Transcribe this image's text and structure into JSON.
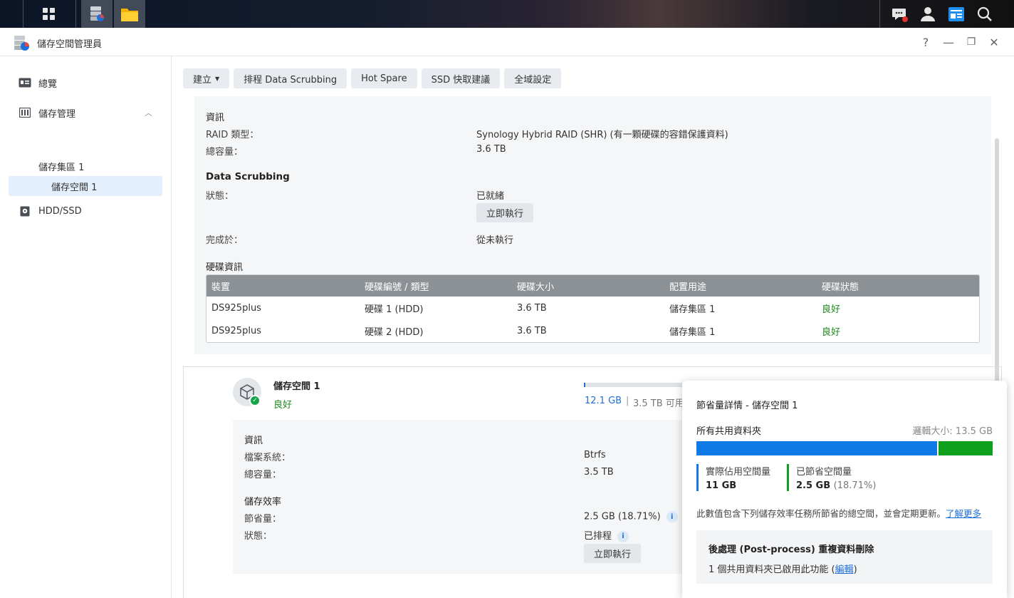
{
  "app": {
    "title": "儲存空間管理員"
  },
  "window_controls": {
    "help": "?",
    "minimize": "—",
    "restore": "❐",
    "close": "✕"
  },
  "sidebar": {
    "items": [
      {
        "label": "總覽",
        "icon": "overview-icon"
      },
      {
        "label": "儲存管理",
        "icon": "storage-icon"
      },
      {
        "label": "儲存集區 1"
      },
      {
        "label": "儲存空間 1"
      },
      {
        "label": "HDD/SSD",
        "icon": "hdd-icon"
      }
    ]
  },
  "toolbar": {
    "create": "建立",
    "schedule": "排程 Data Scrubbing",
    "hotspare": "Hot Spare",
    "ssd": "SSD 快取建議",
    "global": "全域設定"
  },
  "pool": {
    "info_title": "資訊",
    "raid_label": "RAID 類型：",
    "raid_value": "Synology Hybrid RAID (SHR) (有一顆硬碟的容錯保護資料)",
    "capacity_label": "總容量：",
    "capacity_value": "3.6 TB",
    "scrub_title": "Data Scrubbing",
    "status_label": "狀態：",
    "status_value": "已就緒",
    "run_now": "立即執行",
    "completed_label": "完成於：",
    "completed_value": "從未執行",
    "disk_title": "硬碟資訊",
    "table": {
      "headers": [
        "裝置",
        "硬碟編號 / 類型",
        "硬碟大小",
        "配置用途",
        "硬碟狀態"
      ],
      "rows": [
        [
          "DS925plus",
          "硬碟 1 (HDD)",
          "3.6 TB",
          "儲存集區 1",
          "良好"
        ],
        [
          "DS925plus",
          "硬碟 2 (HDD)",
          "3.6 TB",
          "儲存集區 1",
          "良好"
        ]
      ]
    }
  },
  "volume": {
    "name": "儲存空間 1",
    "status": "良好",
    "used": "12.1 GB",
    "separator": "|",
    "available": "3.5 TB 可用",
    "info_title": "資訊",
    "fs_label": "檔案系統：",
    "fs_value": "Btrfs",
    "capacity_label": "總容量：",
    "capacity_value": "3.5 TB",
    "eff_title": "儲存效率",
    "saved_label": "節省量：",
    "saved_value": "2.5 GB (18.71%)",
    "state_label": "狀態：",
    "state_value": "已排程",
    "run_now": "立即執行"
  },
  "popover": {
    "title": "節省量詳情 - 儲存空間 1",
    "shared_label": "所有共用資料夾",
    "logical_size": "邏輯大小: 13.5 GB",
    "used_fraction": 0.8129,
    "colors": {
      "used": "#0f7ae5",
      "saved": "#0e9f1c"
    },
    "used_title": "實際佔用空間量",
    "used_value": "11 GB",
    "saved_title": "已節省空間量",
    "saved_value": "2.5 GB",
    "saved_pct": "(18.71%)",
    "note": "此數值包含下列儲存效率任務所節省的總空間，並會定期更新。",
    "learn_more": "了解更多",
    "pp_title": "後處理 (Post-process) 重複資料刪除",
    "pp_text": "1 個共用資料夾已啟用此功能 (",
    "pp_link": "編輯",
    "pp_close": ")"
  }
}
